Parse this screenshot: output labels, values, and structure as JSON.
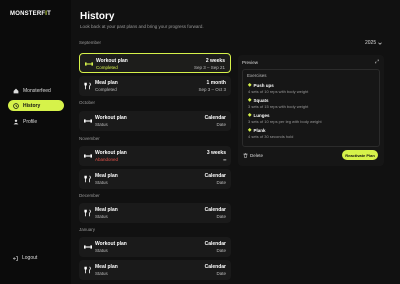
{
  "brand": {
    "name_main": "MONSTERF",
    "name_accent": "I",
    "name_tail": "T"
  },
  "sidebar": {
    "items": [
      {
        "label": "Monsterfeed",
        "icon": "home-icon"
      },
      {
        "label": "History",
        "icon": "history-icon"
      },
      {
        "label": "Profile",
        "icon": "user-icon"
      }
    ],
    "logout": "Logout"
  },
  "header": {
    "title": "History",
    "subtitle": "Look back at your past plans and bring your progress forward.",
    "year": "2025"
  },
  "months": {
    "september": "September",
    "october": "October",
    "november": "November",
    "december": "December",
    "january": "January"
  },
  "cards": [
    {
      "name": "Workout plan",
      "sub": "Completed",
      "right1": "2 weeks",
      "right2": "Sep 3 – Sep 21",
      "type": "workout"
    },
    {
      "name": "Meal plan",
      "sub": "Completed",
      "right1": "1 month",
      "right2": "Sep 3 – Oct 3",
      "type": "meal"
    },
    {
      "name": "Workout plan",
      "sub": "Status",
      "right1": "Calendar",
      "right2": "Date",
      "type": "workout"
    },
    {
      "name": "Workout plan",
      "sub": "Abandoned",
      "right1": "3 weeks",
      "right2": "",
      "type": "workout"
    },
    {
      "name": "Meal plan",
      "sub": "Status",
      "right1": "Calendar",
      "right2": "Date",
      "type": "meal"
    },
    {
      "name": "Meal plan",
      "sub": "Status",
      "right1": "Calendar",
      "right2": "Date",
      "type": "meal"
    },
    {
      "name": "Workout plan",
      "sub": "Status",
      "right1": "Calendar",
      "right2": "Date",
      "type": "workout"
    },
    {
      "name": "Meal plan",
      "sub": "Status",
      "right1": "Calendar",
      "right2": "Date",
      "type": "meal"
    }
  ],
  "preview": {
    "title": "Preview",
    "section": "Exercises",
    "exercises": [
      {
        "name": "Push ups",
        "desc": "4 sets of 10 reps with body weight"
      },
      {
        "name": "Squats",
        "desc": "3 sets of 15 reps with body weight"
      },
      {
        "name": "Lunges",
        "desc": "3 sets of 10 reps per leg with body weight"
      },
      {
        "name": "Plank",
        "desc": "4 sets of 30 seconds hold"
      }
    ],
    "delete": "Delete",
    "action": "Reactivate Plan"
  },
  "colors": {
    "accent": "#d6f24a",
    "background": "#111111",
    "card": "#1a1a1a",
    "danger": "#e0524a"
  }
}
